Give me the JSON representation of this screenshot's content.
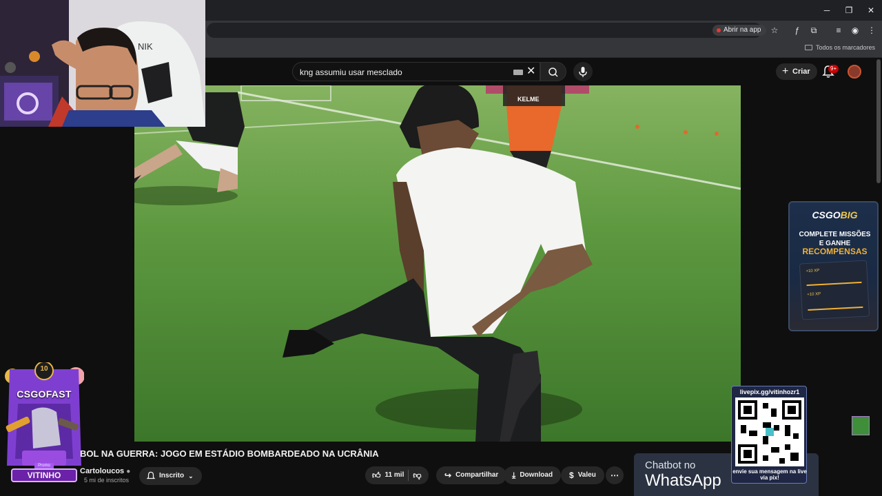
{
  "browser": {
    "open_app_label": "Abrir na app",
    "bookmarks_all_label": "Todos os marcadores",
    "window_controls": [
      "─",
      "❐",
      "✕"
    ]
  },
  "youtube": {
    "search_query": "kng assumiu usar mesclado",
    "create_label": "Criar",
    "notification_count": "9+"
  },
  "video": {
    "title": "BOL NA GUERRA: JOGO EM ESTÁDIO BOMBARDEADO NA UCRÂNIA",
    "channel": "Cartoloucos",
    "subscribers": "5 mi de inscritos",
    "subscribe_label": "Inscrito",
    "likes": "11 mil",
    "share_label": "Compartilhar",
    "download_label": "Download",
    "thanks_label": "Valeu",
    "shirt_text": "KELME"
  },
  "overlays": {
    "csgofast": {
      "label": "CSGOFAST",
      "badge": "10",
      "promo": "Promo",
      "name": "VITINHO"
    },
    "csgobig": {
      "logo_a": "CSGO",
      "logo_b": "BIG",
      "line1": "COMPLETE MISSÕES",
      "line2": "E GANHE",
      "line3": "RECOMPENSAS",
      "card_xp1": "+10 XP",
      "card_xp2": "+10 XP"
    },
    "livepix": {
      "url": "livepix.gg/vitinhozr1",
      "caption": "envie sua mensagem na live via pix!"
    },
    "chatbot": {
      "line1": "Chatbot no",
      "line2": "WhatsApp"
    }
  },
  "colors": {
    "youtube_bg": "#0f0f0f",
    "pill_bg": "#272727",
    "accent_red": "#cc0000",
    "pitch_green": "#5f9a43",
    "shirt_orange": "#e8692b"
  }
}
